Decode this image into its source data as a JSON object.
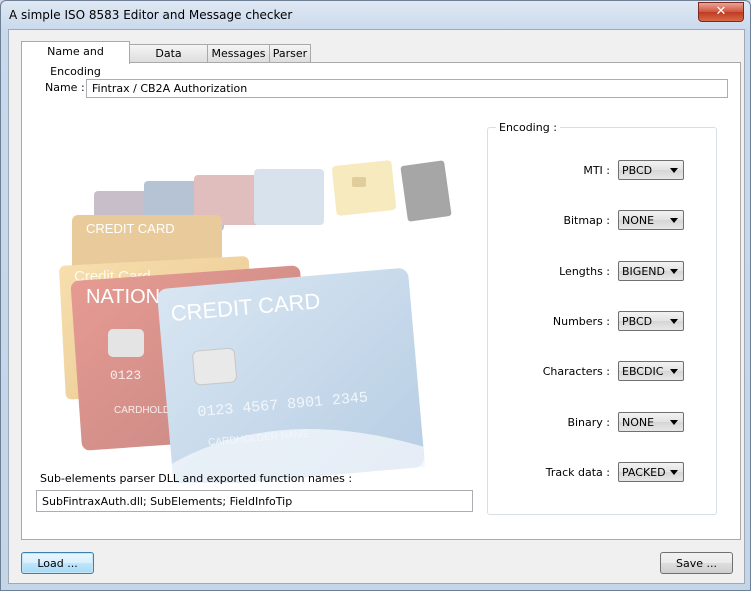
{
  "window": {
    "title": "A simple ISO 8583 Editor and Message checker",
    "close_glyph": "✕"
  },
  "tabs": [
    {
      "label": "Name and Encoding"
    },
    {
      "label": "Data Elements"
    },
    {
      "label": "Messages"
    },
    {
      "label": "Parser"
    }
  ],
  "name": {
    "label": "Name :",
    "value": "Fintrax / CB2A Authorization"
  },
  "illustration": {
    "texts": [
      "CREDIT CARD",
      "NATIONAL BANK",
      "Credit Card",
      "CREDIT CARD",
      "CARDHOLDER",
      "0123 4567 8901 2345",
      "CARDHOLDER NAME"
    ]
  },
  "encoding": {
    "label": "Encoding :",
    "rows": [
      {
        "label": "MTI :",
        "value": "PBCD"
      },
      {
        "label": "Bitmap :",
        "value": "NONE"
      },
      {
        "label": "Lengths :",
        "value": "BIGEND"
      },
      {
        "label": "Numbers :",
        "value": "PBCD"
      },
      {
        "label": "Characters :",
        "value": "EBCDIC"
      },
      {
        "label": "Binary :",
        "value": "NONE"
      },
      {
        "label": "Track data :",
        "value": "PACKED"
      }
    ]
  },
  "subelements": {
    "label": "Sub-elements parser DLL and exported function names :",
    "value": "SubFintraxAuth.dll; SubElements; FieldInfoTip"
  },
  "buttons": {
    "load": "Load ...",
    "save": "Save ..."
  }
}
